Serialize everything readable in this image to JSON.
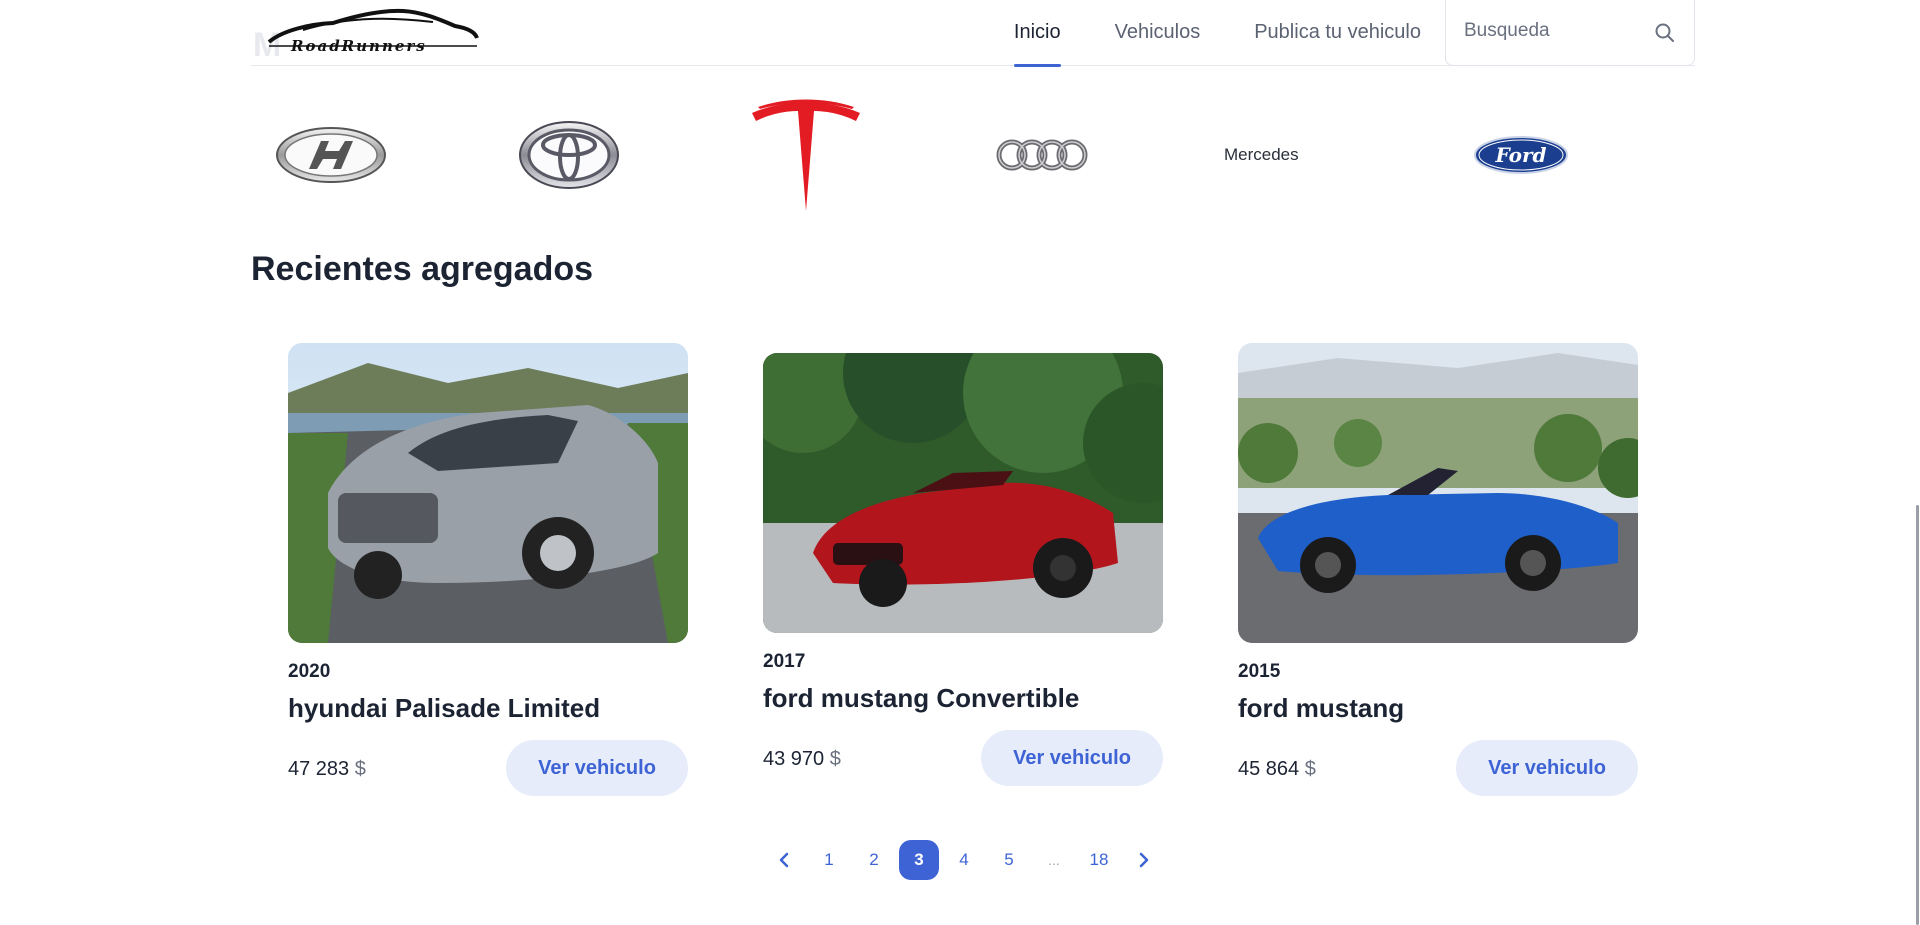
{
  "header": {
    "logo_text": "RoadRunners",
    "logo_ghost": "M",
    "nav": [
      "Inicio",
      "Vehiculos",
      "Publica tu vehiculo"
    ],
    "search_placeholder": "Busqueda"
  },
  "brands": {
    "items": [
      "hyundai-logo",
      "toyota-logo",
      "tesla-logo",
      "audi-logo",
      "Mercedes",
      "ford-logo"
    ],
    "mercedes_alt": "Mercedes",
    "ford_text": "Ford"
  },
  "section": {
    "title": "Recientes agregados"
  },
  "cars": [
    {
      "year": "2020",
      "title": "hyundai Palisade Limited",
      "price": "47 283",
      "currency": "$",
      "button": "Ver vehiculo",
      "color": "#9aa0a8"
    },
    {
      "year": "2017",
      "title": "ford mustang Convertible",
      "price": "43 970",
      "currency": "$",
      "button": "Ver vehiculo",
      "color": "#b3151d"
    },
    {
      "year": "2015",
      "title": "ford mustang",
      "price": "45 864",
      "currency": "$",
      "button": "Ver vehiculo",
      "color": "#1f5fc9"
    }
  ],
  "pagination": {
    "pages": [
      "1",
      "2",
      "3",
      "4",
      "5",
      "...",
      "18"
    ],
    "current": "3"
  },
  "colors": {
    "accent": "#3d63d4",
    "button_bg": "#e7ecfb",
    "tesla_red": "#e31b23",
    "ford_blue": "#1b3e8f"
  }
}
